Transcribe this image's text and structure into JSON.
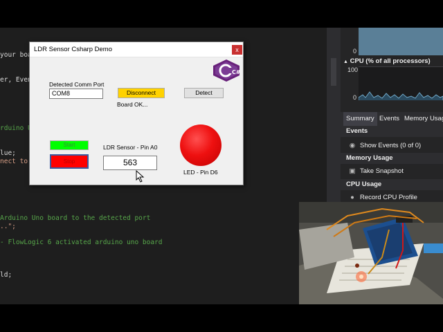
{
  "editor": {
    "lines": [
      {
        "text": "your boa",
        "color": "white"
      },
      {
        "text": "er, Event",
        "color": "white"
      },
      {
        "text": "rduino Un",
        "color": "green"
      },
      {
        "text": "lue;",
        "color": "white"
      },
      {
        "text": "nect to t",
        "color": "string"
      },
      {
        "text": "Arduino Uno board to the detected port",
        "color": "green"
      },
      {
        "text": "..\";",
        "color": "string"
      },
      {
        "text": "- FlowLogic 6 activated arduino uno board",
        "color": "green"
      },
      {
        "text": "ld;",
        "color": "white"
      }
    ]
  },
  "diagnostics": {
    "graph1_zero": "0",
    "cpu_title": "CPU (% of all processors)",
    "cpu_max": "100",
    "cpu_zero": "0",
    "tabs": [
      {
        "label": "Summary",
        "active": true
      },
      {
        "label": "Events",
        "active": false
      },
      {
        "label": "Memory Usag",
        "active": false
      }
    ],
    "sections": {
      "events": {
        "title": "Events",
        "item": "Show Events (0 of 0)"
      },
      "memory": {
        "title": "Memory Usage",
        "item": "Take Snapshot"
      },
      "cpu": {
        "title": "CPU Usage",
        "item": "Record CPU Profile"
      }
    }
  },
  "form": {
    "title": "LDR Sensor Csharp Demo",
    "close_glyph": "x",
    "comm_port_label": "Detected Comm Port",
    "comm_port_value": "COM8",
    "disconnect_label": "Disconnect",
    "detect_label": "Detect",
    "board_status": "Board OK...",
    "start_label": "Start",
    "stop_label": "Stop",
    "sensor_label": "LDR Sensor - Pin A0",
    "sensor_value": "563",
    "led_label": "LED - Pin D6",
    "logo_letter": "C#"
  },
  "colors": {
    "led": "#e81010",
    "disconnect": "#ffd200",
    "start": "#00ff00",
    "stop": "#ff0000",
    "vs_graph": "#5a7f97"
  },
  "icons": {
    "events": "eye-icon",
    "memory": "camera-icon",
    "cpu": "record-icon"
  }
}
